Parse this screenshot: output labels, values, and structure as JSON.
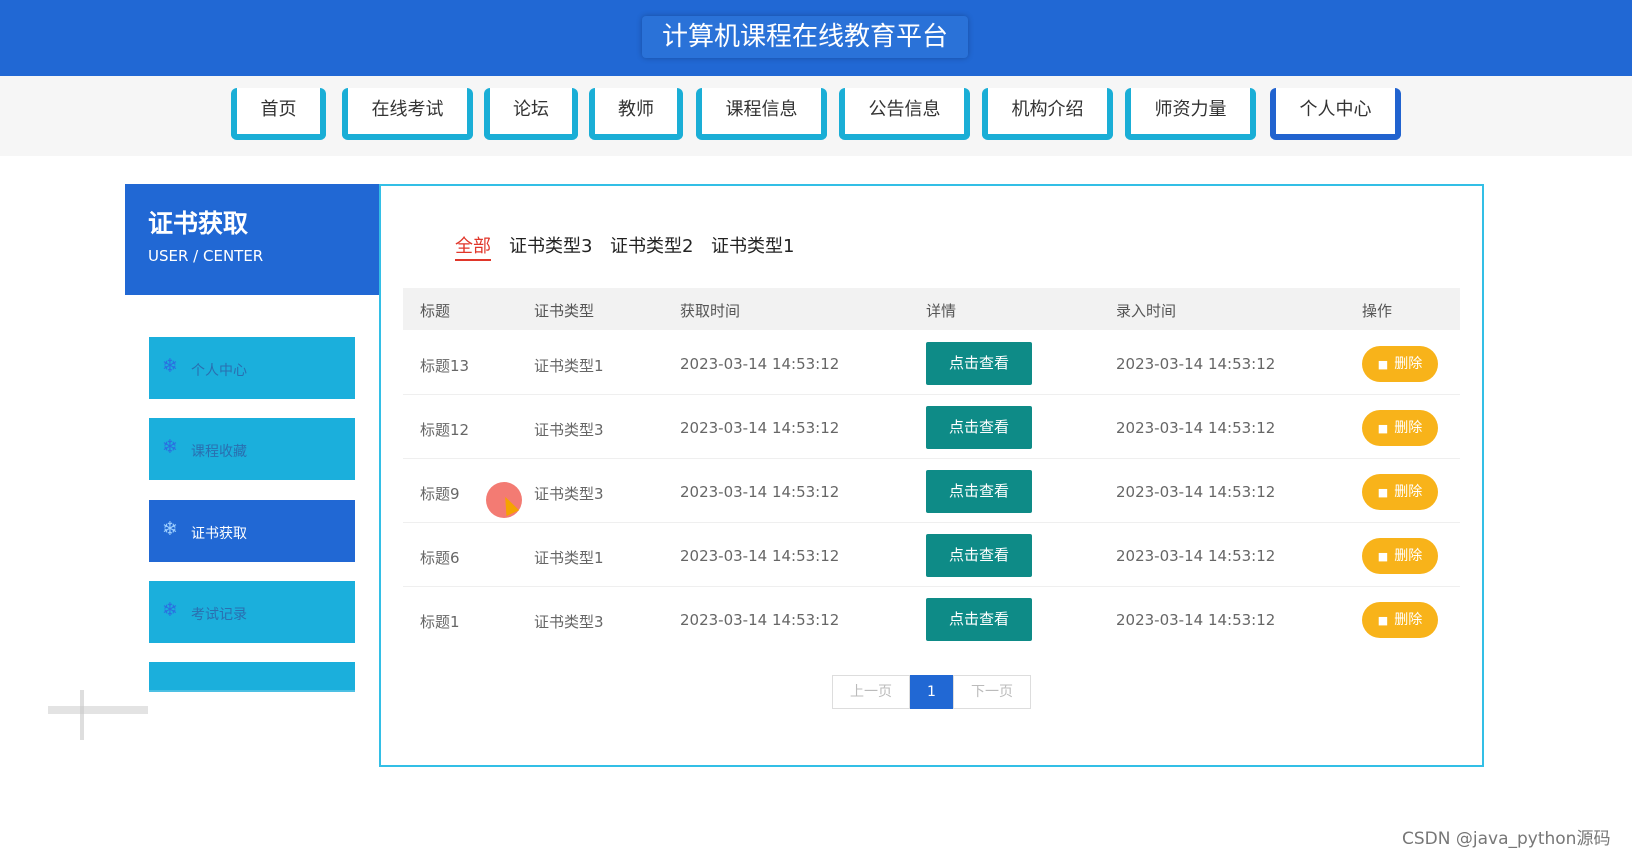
{
  "site": {
    "title": "计算机课程在线教育平台"
  },
  "nav": [
    {
      "label": "首页"
    },
    {
      "label": "在线考试"
    },
    {
      "label": "论坛"
    },
    {
      "label": "教师"
    },
    {
      "label": "课程信息"
    },
    {
      "label": "公告信息"
    },
    {
      "label": "机构介绍"
    },
    {
      "label": "师资力量"
    },
    {
      "label": "个人中心",
      "active": true
    }
  ],
  "sidebar": {
    "title": "证书获取",
    "subtitle": "USER / CENTER",
    "items": [
      {
        "label": "个人中心",
        "icon": "snowflake-icon"
      },
      {
        "label": "课程收藏",
        "icon": "snowflake-icon"
      },
      {
        "label": "证书获取",
        "icon": "snowflake-icon",
        "active": true
      },
      {
        "label": "考试记录",
        "icon": "snowflake-icon"
      }
    ]
  },
  "filters": [
    {
      "label": "全部",
      "active": true
    },
    {
      "label": "证书类型3"
    },
    {
      "label": "证书类型2"
    },
    {
      "label": "证书类型1"
    }
  ],
  "table": {
    "columns": [
      "标题",
      "证书类型",
      "获取时间",
      "详情",
      "录入时间",
      "操作"
    ],
    "view_label": "点击查看",
    "delete_label": "删除",
    "rows": [
      {
        "title": "标题13",
        "type": "证书类型1",
        "obtained": "2023-03-14 14:53:12",
        "entered": "2023-03-14 14:53:12"
      },
      {
        "title": "标题12",
        "type": "证书类型3",
        "obtained": "2023-03-14 14:53:12",
        "entered": "2023-03-14 14:53:12"
      },
      {
        "title": "标题9",
        "type": "证书类型3",
        "obtained": "2023-03-14 14:53:12",
        "entered": "2023-03-14 14:53:12"
      },
      {
        "title": "标题6",
        "type": "证书类型1",
        "obtained": "2023-03-14 14:53:12",
        "entered": "2023-03-14 14:53:12"
      },
      {
        "title": "标题1",
        "type": "证书类型3",
        "obtained": "2023-03-14 14:53:12",
        "entered": "2023-03-14 14:53:12"
      }
    ]
  },
  "pagination": {
    "prev": "上一页",
    "current": "1",
    "next": "下一页"
  },
  "watermark": "CSDN @java_python源码",
  "colors": {
    "primary": "#2168d4",
    "accent_cyan": "#1bafdc",
    "view_button": "#0e8b87",
    "delete_button": "#f8b31a",
    "active_tab": "#e0362a"
  }
}
